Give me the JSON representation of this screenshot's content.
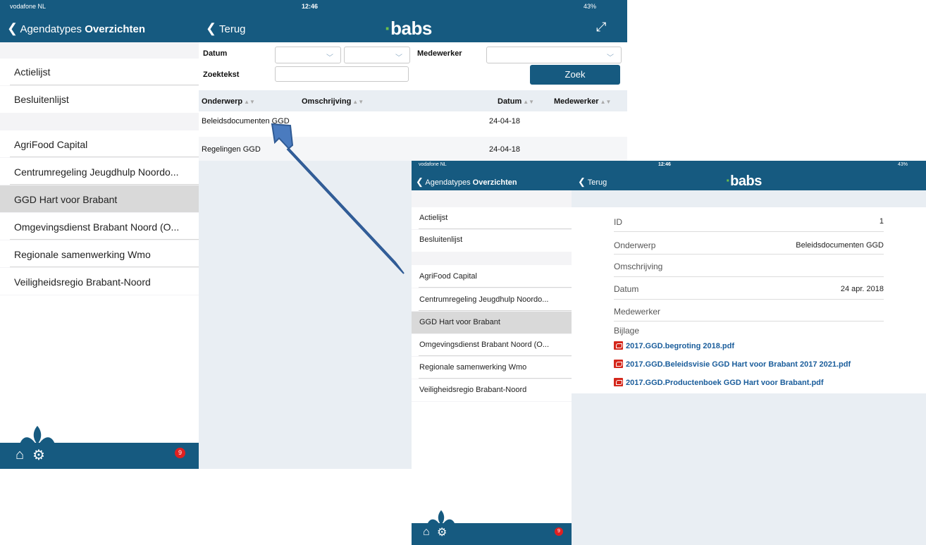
{
  "status": {
    "carrier": "vodafone NL",
    "time": "12:46",
    "battery": "43%"
  },
  "app_logo": "babs",
  "nav": {
    "back_label": "Agendatypes",
    "title": "Overzichten",
    "terug_label": "Terug"
  },
  "list_group1": [
    "Actielijst",
    "Besluitenlijst"
  ],
  "list_group2": [
    "AgriFood Capital",
    "Centrumregeling Jeugdhulp Noordo...",
    "GGD Hart voor Brabant",
    "Omgevingsdienst Brabant Noord (O...",
    "Regionale samenwerking Wmo",
    "Veiligheidsregio Brabant-Noord"
  ],
  "selected_item": "GGD Hart voor Brabant",
  "notification_count": "9",
  "filters": {
    "datum_label": "Datum",
    "medewerker_label": "Medewerker",
    "zoektekst_label": "Zoektekst",
    "zoek_button": "Zoek",
    "zoektekst_value": ""
  },
  "table": {
    "columns": [
      "Onderwerp",
      "Omschrijving",
      "Datum",
      "Medewerker"
    ],
    "rows": [
      {
        "onderwerp": "Beleidsdocumenten GGD",
        "omschrijving": "",
        "datum": "24-04-18",
        "medewerker": ""
      },
      {
        "onderwerp": "Regelingen GGD",
        "omschrijving": "",
        "datum": "24-04-18",
        "medewerker": ""
      }
    ]
  },
  "detail": {
    "id_label": "ID",
    "id_value": "1",
    "onderwerp_label": "Onderwerp",
    "onderwerp_value": "Beleidsdocumenten GGD",
    "omschrijving_label": "Omschrijving",
    "datum_label": "Datum",
    "datum_value": "24 apr. 2018",
    "medewerker_label": "Medewerker",
    "bijlage_label": "Bijlage",
    "attachments": [
      "2017.GGD.begroting 2018.pdf",
      "2017.GGD.Beleidsvisie GGD Hart voor Brabant 2017 2021.pdf",
      "2017.GGD.Productenboek GGD Hart voor Brabant.pdf"
    ]
  },
  "colors": {
    "brand": "#165a80",
    "accent": "#6cc04a",
    "arrow": "#4a7bbf",
    "badge": "#e02020"
  }
}
